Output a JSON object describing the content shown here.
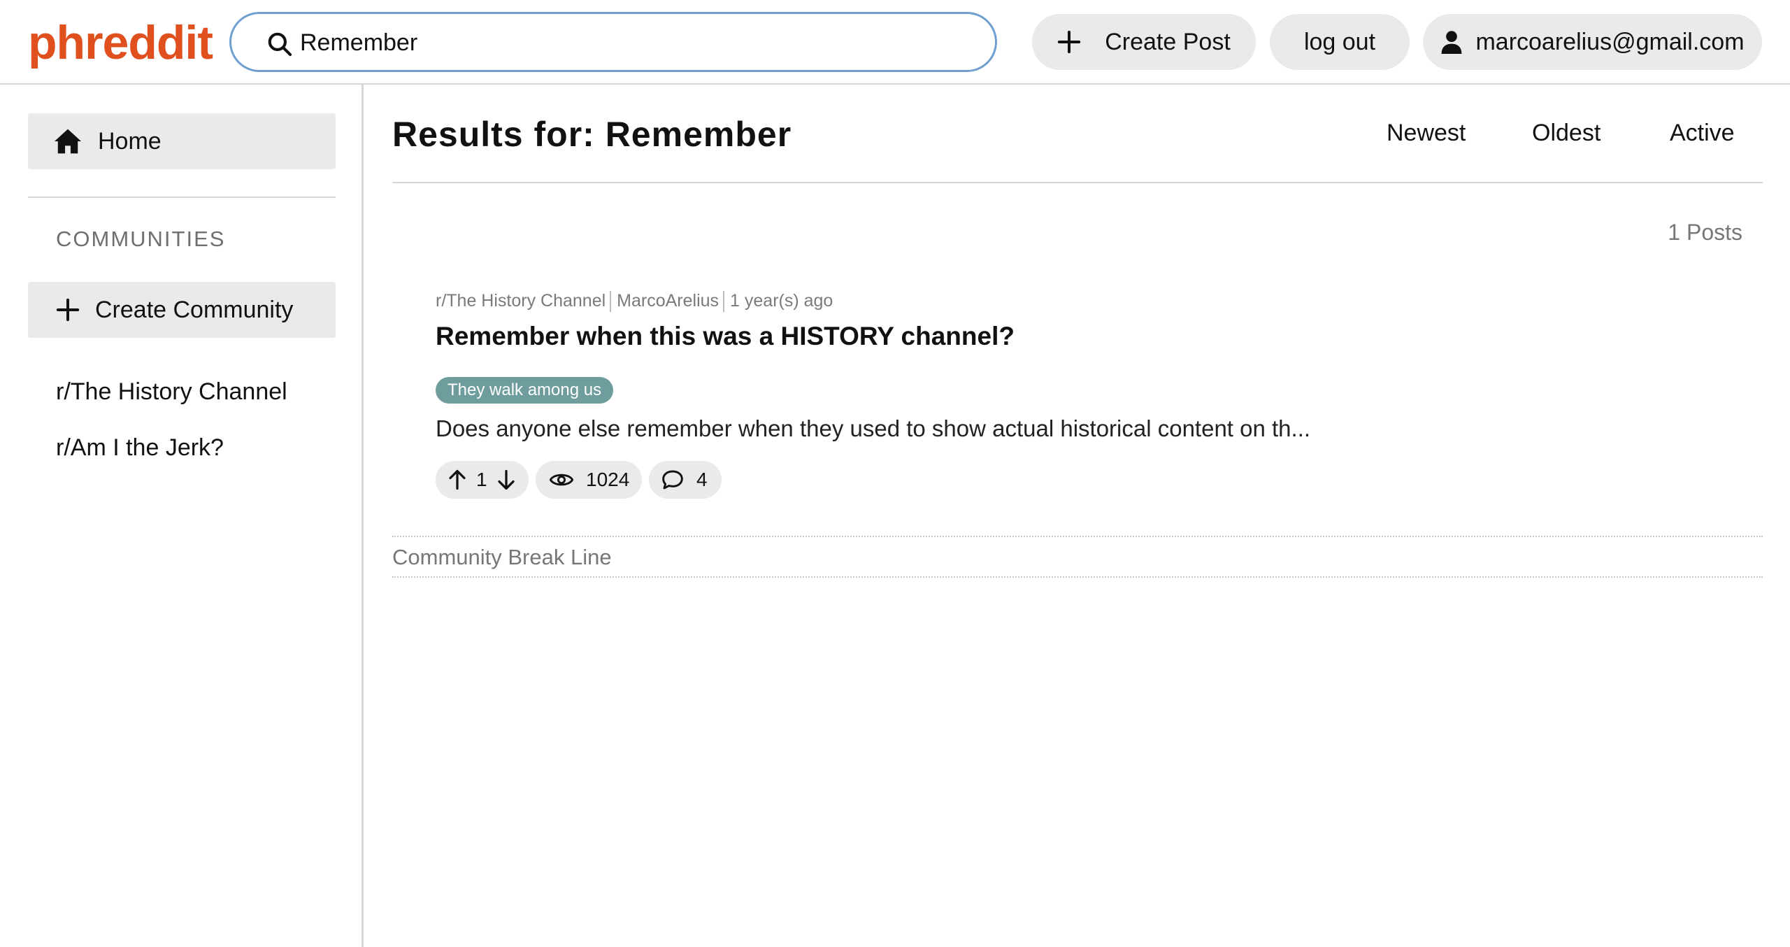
{
  "app": {
    "logo": "phreddit"
  },
  "header": {
    "search": {
      "value": "Remember",
      "placeholder": ""
    },
    "create_post_label": "Create Post",
    "logout_label": "log out",
    "user_label": "marcoarelius@gmail.com"
  },
  "sidebar": {
    "home_label": "Home",
    "communities_heading": "COMMUNITIES",
    "create_community_label": "Create Community",
    "communities": [
      "r/The History Channel",
      "r/Am I the Jerk?"
    ]
  },
  "main": {
    "results_title": "Results for: Remember",
    "sort": {
      "newest": "Newest",
      "oldest": "Oldest",
      "active": "Active"
    },
    "post_count": "1 Posts",
    "posts": [
      {
        "community": "r/The History Channel",
        "author": "MarcoArelius",
        "time": "1 year(s) ago",
        "title": "Remember when this was a HISTORY channel?",
        "flair": "They walk among us",
        "excerpt": "Does anyone else remember when they used to show actual historical content on th...",
        "votes": "1",
        "views": "1024",
        "comments": "4"
      }
    ],
    "break_line_label": "Community Break Line"
  },
  "colors": {
    "logo": "#e0501f",
    "search_border": "#6f9fcf",
    "pill_bg": "#e8eaec",
    "flair_bg": "#6f9c9c",
    "divider": "#d4d6d8"
  },
  "icons": [
    "search-icon",
    "plus-icon",
    "user-icon",
    "home-icon",
    "arrow-up-icon",
    "arrow-down-icon",
    "eye-icon",
    "comment-icon"
  ]
}
